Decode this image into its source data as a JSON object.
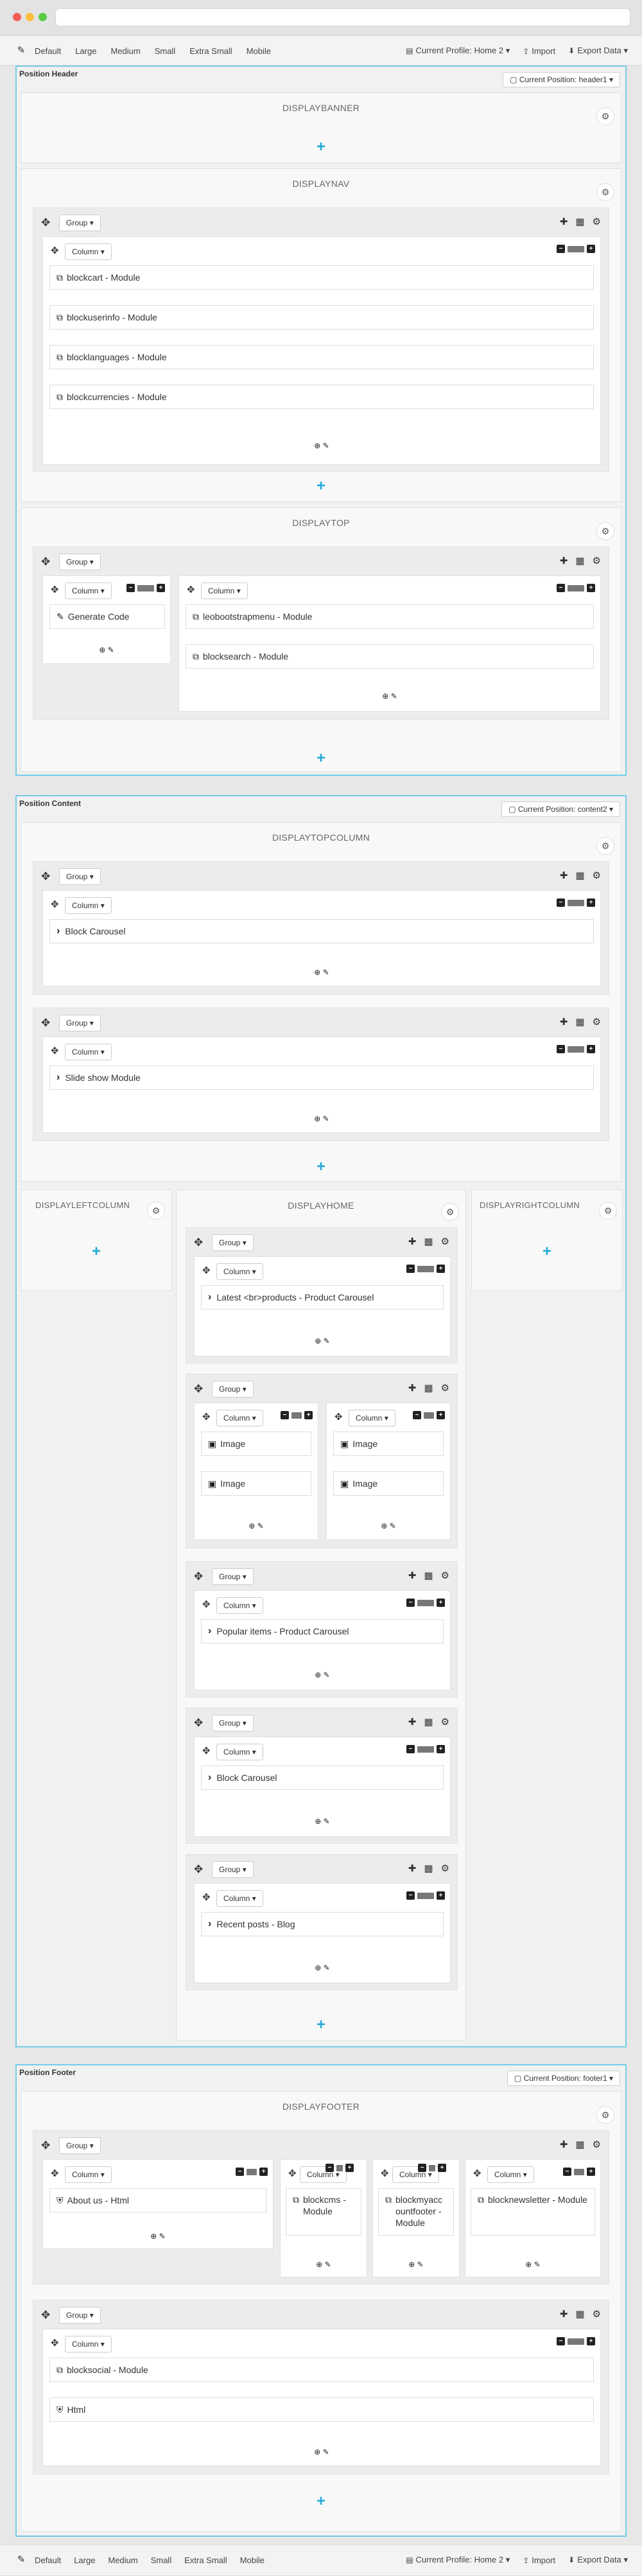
{
  "toolbar": {
    "devices": [
      "Default",
      "Large",
      "Medium",
      "Small",
      "Extra Small",
      "Mobile"
    ],
    "profile": "Current Profile: Home 2",
    "import": "Import",
    "export": "Export Data"
  },
  "header": {
    "title": "Position Header",
    "current": "Current Position: header1",
    "banner": "DISPLAYBANNER",
    "nav": "DISPLAYNAV",
    "top": "DISPLAYTOP",
    "nav_modules": [
      "blockcart - Module",
      "blockuserinfo - Module",
      "blocklanguages - Module",
      "blockcurrencies - Module"
    ],
    "top_left_modules": [
      "Generate Code"
    ],
    "top_right_modules": [
      "leobootstrapmenu - Module",
      "blocksearch - Module"
    ]
  },
  "content": {
    "title": "Position Content",
    "current": "Current Position: content2",
    "topcolumn": "DISPLAYTOPCOLUMN",
    "left": "DISPLAYLEFTCOLUMN",
    "home": "DISPLAYHOME",
    "right": "DISPLAYRIGHTCOLUMN",
    "top_modules": [
      "Block Carousel",
      "Slide show Module"
    ],
    "home_products": "Latest <br>products - Product Carousel",
    "home_images": [
      "Image",
      "Image",
      "Image",
      "Image"
    ],
    "home_popular": "Popular items - Product Carousel",
    "home_carousel": "Block Carousel",
    "home_blog": "Recent posts - Blog"
  },
  "footer": {
    "title": "Position Footer",
    "current": "Current Position: footer1",
    "hook": "DISPLAYFOOTER",
    "about": "About us - Html",
    "cols": [
      "blockcms - Module",
      "blockmyaccountfooter - Module",
      "blocknewsletter - Module"
    ],
    "social": "blocksocial - Module",
    "html": "Html"
  },
  "labels": {
    "group": "Group",
    "column": "Column"
  }
}
